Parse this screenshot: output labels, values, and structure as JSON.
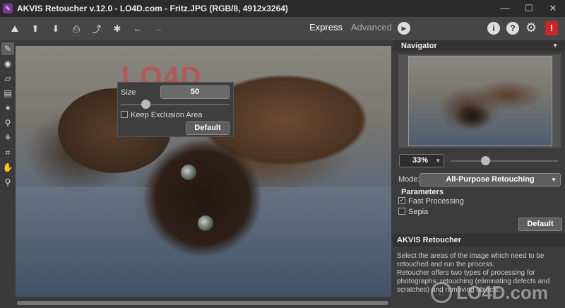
{
  "window": {
    "title": "AKVIS Retoucher v.12.0 - LO4D.com - Fritz.JPG (RGB/8, 4912x3264)",
    "minimize": "—",
    "maximize": "☐",
    "close": "✕"
  },
  "toolbar": {
    "modes": {
      "express": "Express",
      "advanced": "Advanced"
    },
    "help_icon": "?",
    "info_icon": "i",
    "alert_icon": "!"
  },
  "popup": {
    "size_label": "Size",
    "size_value": "50",
    "size_slider_level": 0.23,
    "keep_exclusion_label": "Keep Exclusion Area",
    "keep_exclusion_checked": false,
    "default_button": "Default"
  },
  "navigator": {
    "title": "Navigator",
    "zoom": "33%",
    "zoom_slider_level": 0.32
  },
  "settings": {
    "mode_label": "Mode:",
    "mode_value": "All-Purpose Retouching",
    "parameters_title": "Parameters",
    "fast_processing_label": "Fast Processing",
    "fast_processing_checked": true,
    "sepia_label": "Sepia",
    "sepia_checked": false,
    "default_button": "Default"
  },
  "help": {
    "title": "AKVIS Retoucher",
    "para1": "Select the areas of the image which need to be retouched and run the process.",
    "para2": "Retoucher offers two types of processing for photographs: retouching (eliminating defects and scratches) and removing objects."
  },
  "watermark": {
    "canvas_text": "LO4D",
    "corner_text": "LO4D.com"
  },
  "colors": {
    "accent_alert": "#c62828",
    "panel_bg": "#3c3c3c",
    "toolbar_bg": "#464646"
  }
}
